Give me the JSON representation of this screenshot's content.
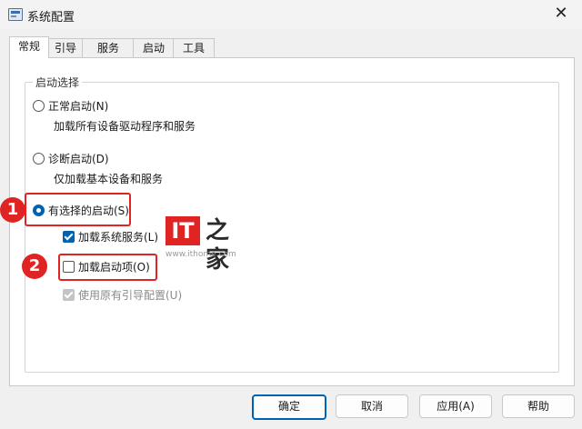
{
  "window": {
    "title": "系统配置",
    "close_glyph": "✕"
  },
  "tabs": [
    {
      "label": "常规",
      "active": true
    },
    {
      "label": "引导",
      "active": false
    },
    {
      "label": "服务",
      "active": false
    },
    {
      "label": "启动",
      "active": false
    },
    {
      "label": "工具",
      "active": false
    }
  ],
  "startup_group": {
    "title": "启动选择",
    "normal": {
      "label": "正常启动(N)",
      "desc": "加载所有设备驱动程序和服务",
      "selected": false
    },
    "diagnostic": {
      "label": "诊断启动(D)",
      "desc": "仅加载基本设备和服务",
      "selected": false
    },
    "selective": {
      "label": "有选择的启动(S)",
      "selected": true
    },
    "load_services": {
      "label": "加载系统服务(L)",
      "checked": true
    },
    "load_startup": {
      "label": "加载启动项(O)",
      "checked": false
    },
    "use_original_boot": {
      "label": "使用原有引导配置(U)",
      "checked": true,
      "disabled": true
    }
  },
  "annotations": {
    "badge1": "1",
    "badge2": "2",
    "highlight_color": "#e02424"
  },
  "watermark": {
    "logo": "IT",
    "brand": "之家",
    "url": "www.ithome.com"
  },
  "buttons": {
    "ok": "确定",
    "cancel": "取消",
    "apply": "应用(A)",
    "help": "帮助"
  },
  "colors": {
    "accent": "#0063b1",
    "annotation": "#e02424"
  },
  "icons": [
    "app-icon",
    "close-icon"
  ]
}
